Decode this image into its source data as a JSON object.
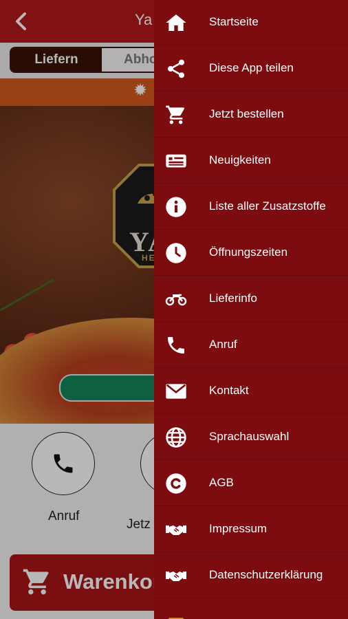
{
  "app": {
    "title": "Ya",
    "segments": {
      "deliver": "Liefern",
      "pickup": "Abho"
    },
    "logo": {
      "text": "YA",
      "sub": "HE"
    },
    "actions": [
      {
        "label": "Anruf",
        "icon": "phone-icon"
      },
      {
        "label": "Jetz",
        "icon": "cart-icon"
      }
    ],
    "cart_label": "Warenkorl"
  },
  "drawer": {
    "items": [
      {
        "label": "Startseite",
        "icon": "home-icon"
      },
      {
        "label": "Diese App teilen",
        "icon": "share-icon"
      },
      {
        "label": "Jetzt bestellen",
        "icon": "cart-icon"
      },
      {
        "label": "Neuigkeiten",
        "icon": "news-icon"
      },
      {
        "label": "Liste aller Zusatzstoffe",
        "icon": "info-icon"
      },
      {
        "label": "Öffnungszeiten",
        "icon": "clock-icon"
      },
      {
        "label": "Lieferinfo",
        "icon": "motorcycle-icon"
      },
      {
        "label": "Anruf",
        "icon": "phone-icon"
      },
      {
        "label": "Kontakt",
        "icon": "mail-icon"
      },
      {
        "label": "Sprachauswahl",
        "icon": "globe-icon"
      },
      {
        "label": "AGB",
        "icon": "copyright-icon"
      },
      {
        "label": "Impressum",
        "icon": "handshake-icon"
      },
      {
        "label": "Datenschutzerklärung",
        "icon": "handshake-icon"
      }
    ]
  },
  "colors": {
    "header": "#b3181b",
    "drawer": "#7c0c0f",
    "notice": "#d55a1f",
    "accent_green": "#13875a"
  }
}
